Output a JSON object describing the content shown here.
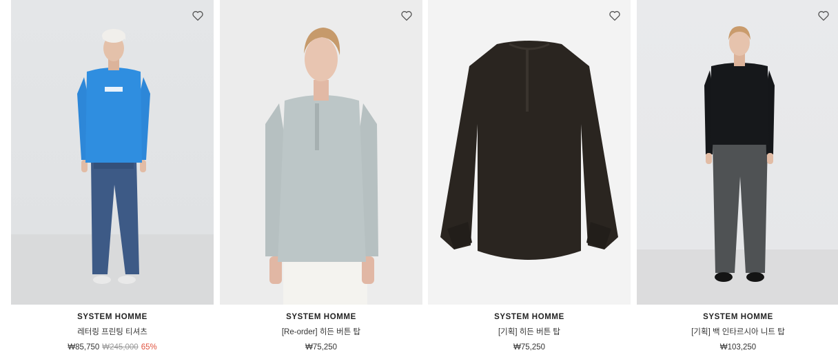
{
  "products": [
    {
      "brand": "SYSTEM HOMME",
      "name": "레터링 프린팅 티셔츠",
      "price": "₩85,750",
      "original_price": "₩245,000",
      "discount": "65%",
      "wishlist_icon": "heart-outline-icon"
    },
    {
      "brand": "SYSTEM HOMME",
      "name": "[Re-order] 히든 버튼 탑",
      "price": "₩75,250",
      "wishlist_icon": "heart-outline-icon"
    },
    {
      "brand": "SYSTEM HOMME",
      "name": "[기획] 히든 버튼 탑",
      "price": "₩75,250",
      "wishlist_icon": "heart-outline-icon"
    },
    {
      "brand": "SYSTEM HOMME",
      "name": "[기획] 백 인타르시아 니트 탑",
      "price": "₩103,250",
      "wishlist_icon": "heart-outline-icon"
    }
  ],
  "colors": {
    "discount": "#e0533f",
    "strikethrough": "#9a9a9a",
    "text": "#222222"
  }
}
